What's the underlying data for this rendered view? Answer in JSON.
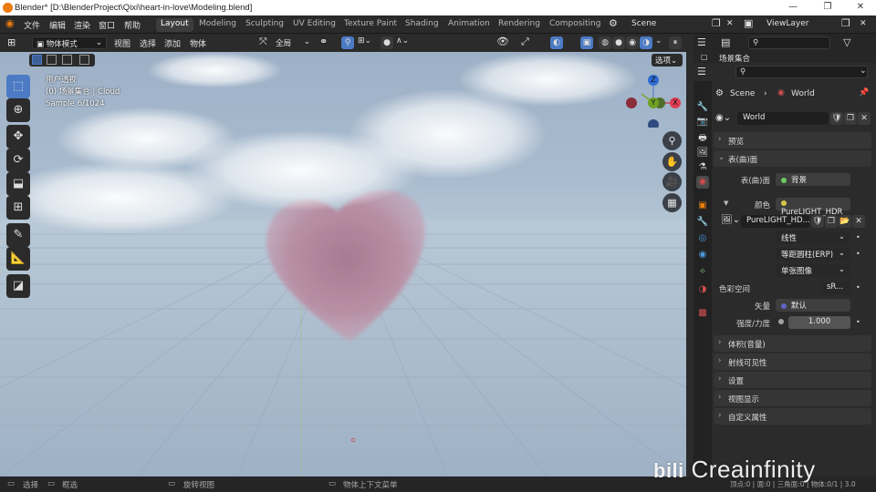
{
  "window": {
    "title": "Blender* [D:\\BlenderProject\\Qixi\\heart-in-love\\Modeling.blend]",
    "minimize": "—",
    "maximize": "❐",
    "close": "✕"
  },
  "menubar": {
    "menus": [
      "文件",
      "编辑",
      "渲染",
      "窗口",
      "帮助"
    ],
    "workspaces": [
      "Layout",
      "Modeling",
      "Sculpting",
      "UV Editing",
      "Texture Paint",
      "Shading",
      "Animation",
      "Rendering",
      "Compositing"
    ],
    "active_workspace": "Layout",
    "scene_label": "Scene",
    "viewlayer_label": "ViewLayer"
  },
  "viewport_header": {
    "mode": "物体模式",
    "menus": [
      "视图",
      "选择",
      "添加",
      "物体"
    ],
    "transform_orientation": "全局",
    "options": "选项"
  },
  "viewport": {
    "overlay_lines": [
      "用户透视",
      "(0) 场景集合 | Cloud",
      "Sample 6/1024"
    ],
    "gizmo": {
      "z": "Z",
      "y": "Y",
      "x": "X"
    },
    "tools": [
      "select-box",
      "cursor",
      "move",
      "rotate",
      "scale",
      "transform",
      "annotate",
      "measure",
      "add-cube"
    ]
  },
  "properties": {
    "search_placeholder": "",
    "outliner_title": "场景集合",
    "breadcrumb": {
      "scene": "Scene",
      "world": "World"
    },
    "world_name": "World",
    "panels": {
      "preview": "预览",
      "surface": "表(曲)面",
      "volume": "体积(音量)",
      "ray_visibility": "射线可见性",
      "settings": "设置",
      "viewport_display": "视图显示",
      "custom_props": "自定义属性"
    },
    "surface": {
      "surface_label": "表(曲)面",
      "surface_value": "背景",
      "color_label": "颜色",
      "color_value": "PureLIGHT_HDR",
      "image_name": "PureLIGHT_HD...",
      "interpolation": "线性",
      "projection": "等距圆柱(ERP)",
      "source": "单张图像",
      "colorspace_label": "色彩空间",
      "colorspace_value": "sR...",
      "vector_label": "矢量",
      "vector_value": "默认",
      "strength_label": "强度/力度",
      "strength_value": "1.000"
    }
  },
  "statusbar": {
    "select": "选择",
    "box_select": "框选",
    "rotate_view": "旋转视图",
    "context_menu": "物体上下文菜单",
    "stats": "顶点:0 | 面:0 | 三角面:0 | 物体:0/1 | 3.0"
  },
  "watermark": "Creainfinity",
  "colors": {
    "accent": "#4c7ac4",
    "heart": "#b98aa0",
    "active_workspace_bg": "#3d3d3d"
  }
}
